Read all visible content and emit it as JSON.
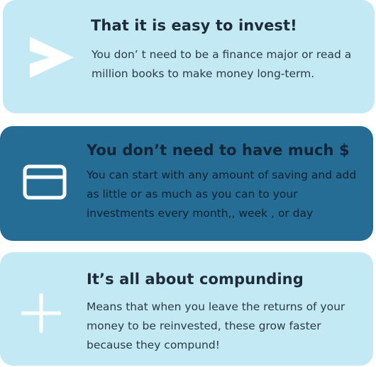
{
  "colors": {
    "light_card": "#c3eaf4",
    "dark_card": "#256d95",
    "icon": "#ffffff",
    "heading_text": "#1d2b3a"
  },
  "cards": [
    {
      "icon": "send-arrow-icon",
      "title": "That it is easy to invest!",
      "text": "You don’ t need to be a finance major or read a million books  to make money long-term."
    },
    {
      "icon": "credit-card-icon",
      "title": "You don’t need to have much $",
      "text": "You can start with any amount of saving and add as little or as much as you can to your investments every month,, week , or day"
    },
    {
      "icon": "plus-icon",
      "title": "It’s all about compunding",
      "text": "Means that when you leave the returns of your money to be reinvested, these grow faster because they compund!"
    }
  ]
}
